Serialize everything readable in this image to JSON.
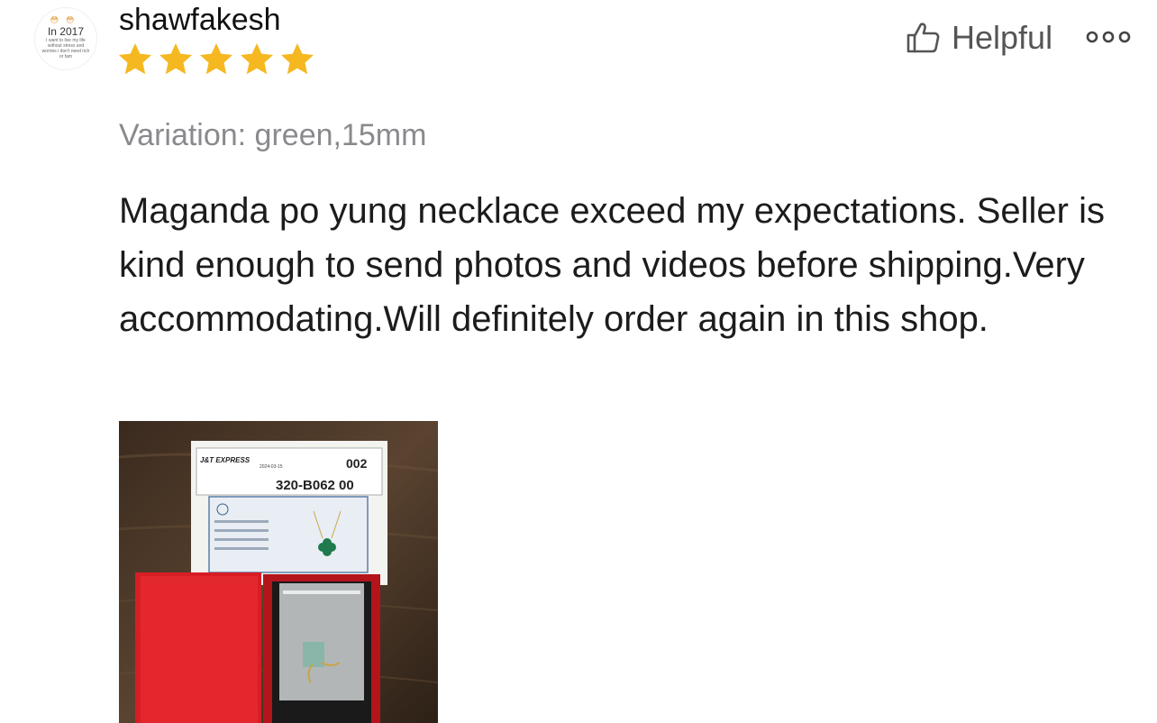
{
  "review": {
    "username": "shawfakesh",
    "rating": 5,
    "rating_max": 5,
    "variation": "Variation: green,15mm",
    "text": "Maganda po yung necklace exceed my expectations. Seller is kind enough to send photos and videos before shipping.Very accommodating.Will definitely order again in this shop.",
    "helpful_label": "Helpful",
    "star_color": "#f5b820",
    "avatar": {
      "emoji": "😳😳",
      "year": "In 2017",
      "caption": "I want to live my life without stress and worries i don't need rich or fam"
    },
    "photo": {
      "label_code": "320-B062 00",
      "label_number": "002",
      "carrier": "J&T EXPRESS",
      "date": "2024-03-15"
    }
  }
}
